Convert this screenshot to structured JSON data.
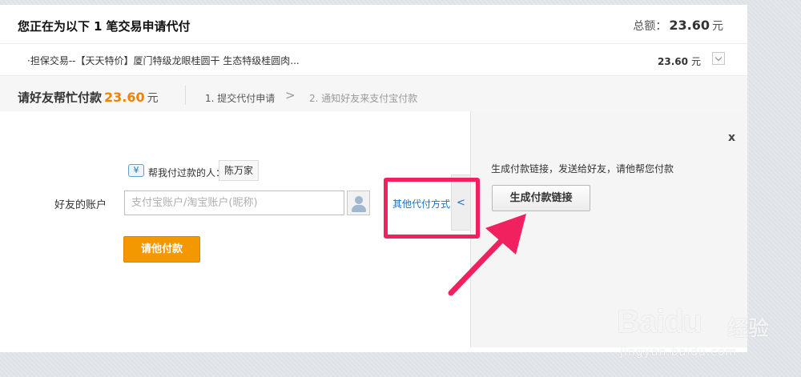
{
  "header": {
    "title_prefix": "您正在为以下",
    "count": "1",
    "title_suffix": "笔交易申请代付",
    "total_label": "总额：",
    "total_amount": "23.60",
    "currency": "元"
  },
  "item": {
    "description": "·担保交易--【天天特价】厦门特级龙眼桂圆干 生态特级桂圆肉...",
    "amount": "23.60",
    "currency": "元"
  },
  "help": {
    "title": "请好友帮忙付款",
    "amount": "23.60",
    "currency": "元",
    "step1": "1. 提交代付申请",
    "step_separator": ">",
    "step2": "2. 通知好友来支付宝付款"
  },
  "form": {
    "payer_label": "帮我付过款的人：",
    "payer_name": "陈万家",
    "account_label": "好友的账户",
    "account_placeholder": "支付宝账户/淘宝账户(昵称)",
    "account_value": "",
    "submit_label": "请他付款",
    "other_methods_label": "其他代付方式",
    "toggle_label": "<"
  },
  "right_panel": {
    "close_label": "x",
    "description": "生成付款链接，发送给好友，请他帮您付款",
    "generate_button": "生成付款链接"
  },
  "watermark": {
    "logo": "Bai",
    "logo_suffix": "du",
    "brand_cn": "经验",
    "url": "jingyan.baidu.com"
  },
  "colors": {
    "accent_orange": "#f39800",
    "amount_orange": "#f08200",
    "link_blue": "#1b6fc2",
    "highlight_pink": "#f0215e"
  },
  "icons": {
    "payer_icon": "yuan-person-icon",
    "contact_icon": "contact-person-icon",
    "dropdown_icon": "chevron-down-icon",
    "arrow_annotation": "pink-arrow"
  }
}
